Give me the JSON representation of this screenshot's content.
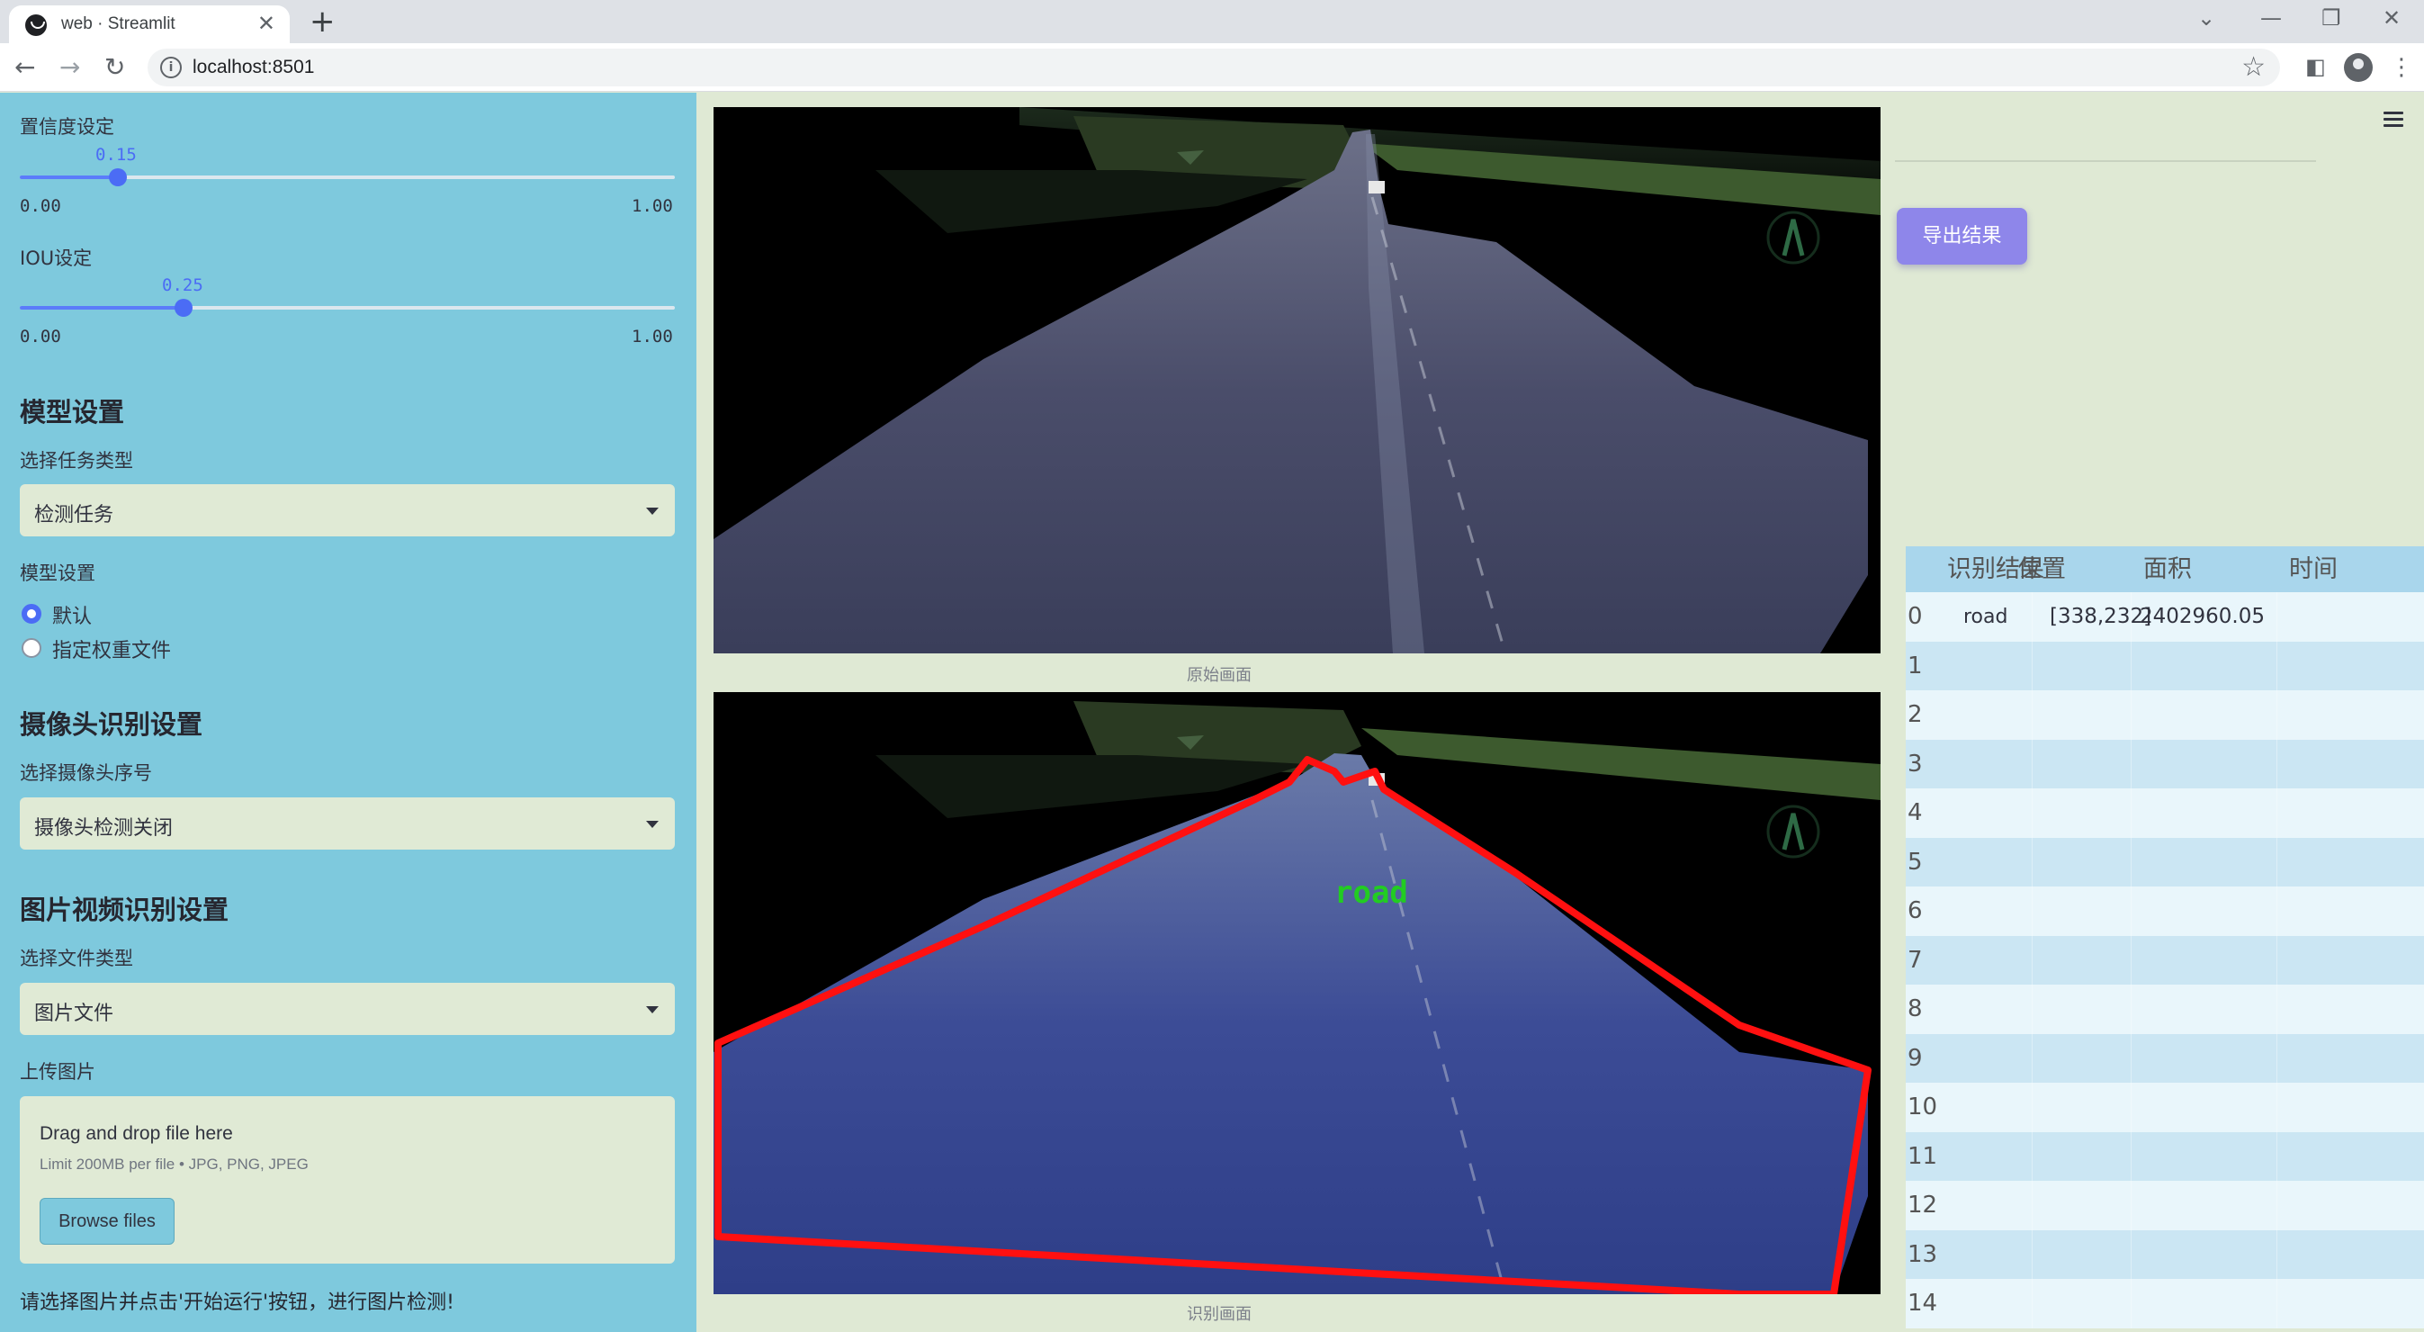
{
  "browser": {
    "tab_title": "web · Streamlit",
    "url": "localhost:8501"
  },
  "sidebar": {
    "confidence": {
      "label": "置信度设定",
      "value": "0.15",
      "min": "0.00",
      "max": "1.00",
      "fraction": 0.15
    },
    "iou": {
      "label": "IOU设定",
      "value": "0.25",
      "min": "0.00",
      "max": "1.00",
      "fraction": 0.25
    },
    "model_section": {
      "title": "模型设置",
      "task_label": "选择任务类型",
      "task_value": "检测任务",
      "weights_label": "模型设置",
      "weights_options": [
        "默认",
        "指定权重文件"
      ],
      "weights_selected": "默认"
    },
    "camera_section": {
      "title": "摄像头识别设置",
      "camera_label": "选择摄像头序号",
      "camera_value": "摄像头检测关闭"
    },
    "file_section": {
      "title": "图片视频识别设置",
      "type_label": "选择文件类型",
      "type_value": "图片文件",
      "upload_label": "上传图片",
      "drop_text": "Drag and drop file here",
      "limit_text": "Limit 200MB per file • JPG, PNG, JPEG",
      "browse_label": "Browse files"
    },
    "hint": "请选择图片并点击'开始运行'按钮，进行图片检测!"
  },
  "main": {
    "original_caption": "原始画面",
    "result_caption": "识别画面",
    "detection_label": "road",
    "export_label": "导出结果"
  },
  "table": {
    "headers": [
      "",
      "识别结果",
      "位置",
      "面积",
      "时间"
    ],
    "rows": [
      [
        "0",
        "road",
        "[338,232]",
        "2402960.05",
        ""
      ],
      [
        "1",
        "",
        "",
        "",
        ""
      ],
      [
        "2",
        "",
        "",
        "",
        ""
      ],
      [
        "3",
        "",
        "",
        "",
        ""
      ],
      [
        "4",
        "",
        "",
        "",
        ""
      ],
      [
        "5",
        "",
        "",
        "",
        ""
      ],
      [
        "6",
        "",
        "",
        "",
        ""
      ],
      [
        "7",
        "",
        "",
        "",
        ""
      ],
      [
        "8",
        "",
        "",
        "",
        ""
      ],
      [
        "9",
        "",
        "",
        "",
        ""
      ],
      [
        "10",
        "",
        "",
        "",
        ""
      ],
      [
        "11",
        "",
        "",
        "",
        ""
      ],
      [
        "12",
        "",
        "",
        "",
        ""
      ],
      [
        "13",
        "",
        "",
        "",
        ""
      ],
      [
        "14",
        "",
        "",
        "",
        ""
      ]
    ]
  },
  "colors": {
    "sidebar_bg": "#7ec9dd",
    "accent": "#4b6cf5",
    "export_button": "#8e86ea",
    "detection_outline": "#ff1010",
    "detection_label": "#22cc22"
  }
}
